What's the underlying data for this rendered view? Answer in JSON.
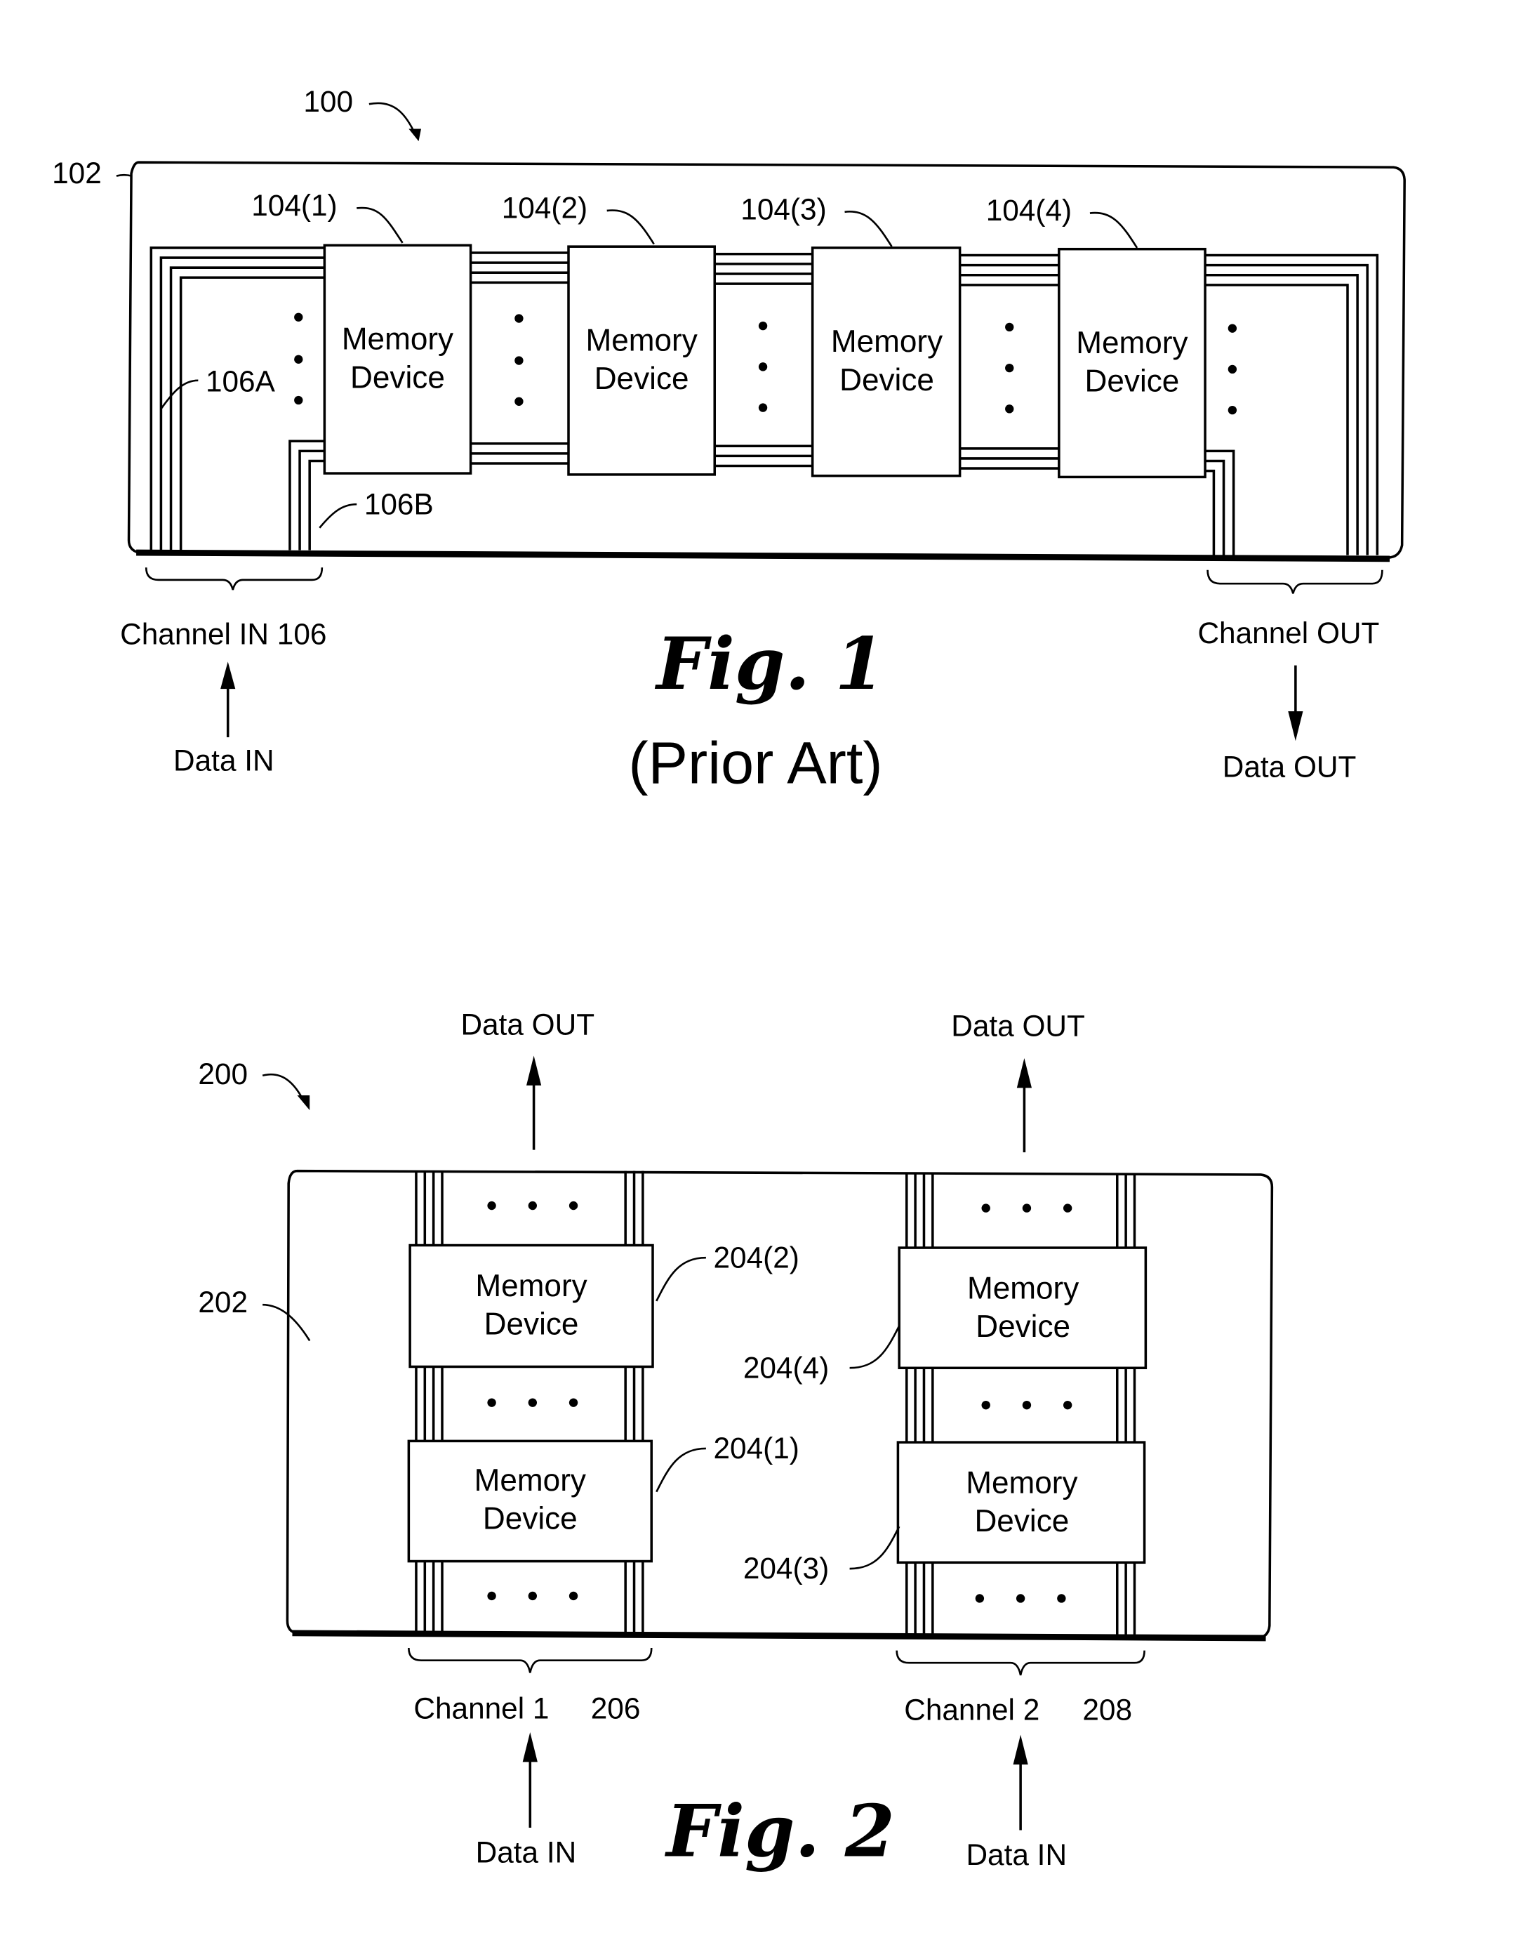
{
  "figure1": {
    "ref_assembly": "100",
    "ref_board": "102",
    "devices": [
      {
        "ref": "104(1)",
        "line1": "Memory",
        "line2": "Device"
      },
      {
        "ref": "104(2)",
        "line1": "Memory",
        "line2": "Device"
      },
      {
        "ref": "104(3)",
        "line1": "Memory",
        "line2": "Device"
      },
      {
        "ref": "104(4)",
        "line1": "Memory",
        "line2": "Device"
      }
    ],
    "ref_bus_a": "106A",
    "ref_bus_b": "106B",
    "channel_in_label": "Channel IN 106",
    "channel_out_label": "Channel OUT",
    "data_in_label": "Data IN",
    "data_out_label": "Data OUT",
    "title": "Fig. 1",
    "subtitle": "(Prior Art)"
  },
  "figure2": {
    "ref_assembly": "200",
    "ref_board": "202",
    "devices": [
      {
        "ref": "204(1)",
        "line1": "Memory",
        "line2": "Device"
      },
      {
        "ref": "204(2)",
        "line1": "Memory",
        "line2": "Device"
      },
      {
        "ref": "204(3)",
        "line1": "Memory",
        "line2": "Device"
      },
      {
        "ref": "204(4)",
        "line1": "Memory",
        "line2": "Device"
      }
    ],
    "channel1_label": "Channel 1",
    "channel1_ref": "206",
    "channel2_label": "Channel 2",
    "channel2_ref": "208",
    "data_in_label": "Data IN",
    "data_out_label": "Data OUT",
    "title": "Fig. 2"
  }
}
